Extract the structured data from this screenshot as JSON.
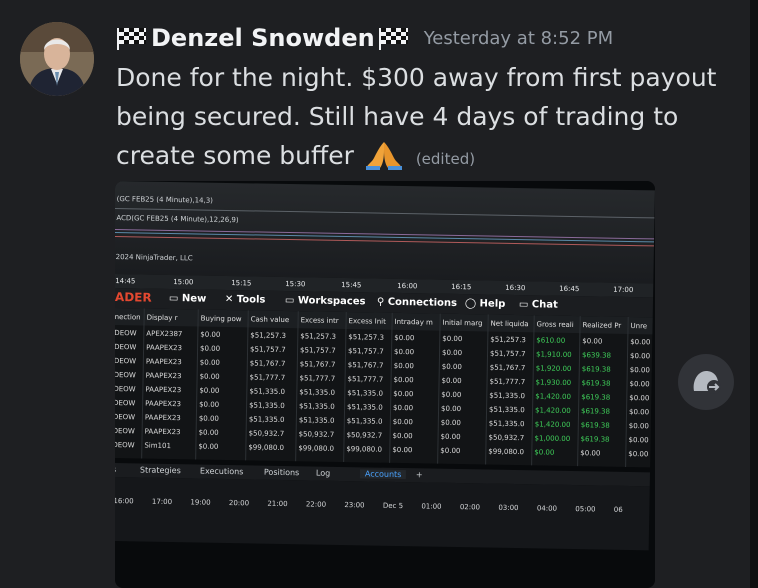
{
  "message": {
    "username": "Denzel Snowden",
    "timestamp": "Yesterday at 8:52 PM",
    "text": "Done for the night. $300 away from first payout being secured. Still have 4 days of trading to create some buffer",
    "edited": "(edited)",
    "flag_icon": "checkered-flag-icon",
    "emoji_icon": "folded-hands-icon"
  },
  "screenshot": {
    "indicators": [
      "(GC FEB25 (4 Minute),14,3)",
      "ACD(GC FEB25 (4 Minute),12,26,9)"
    ],
    "copyright": "2024 NinjaTrader, LLC",
    "top_times": [
      "14:45",
      "15:00",
      "15:15",
      "15:30",
      "15:45",
      "16:00",
      "16:15",
      "16:30",
      "16:45",
      "17:00"
    ],
    "brand": "ADER",
    "menu": [
      "New",
      "Tools",
      "Workspaces",
      "Connections",
      "Help",
      "Chat"
    ],
    "columns": [
      "nection",
      "Display r",
      "Buying pow",
      "Cash value",
      "Excess intr",
      "Excess Init",
      "Intraday m",
      "Initial marg",
      "Net liquida",
      "Gross reali",
      "Realized Pr",
      "Unre"
    ],
    "rows": [
      [
        "DEOW",
        "APEX2387",
        "$0.00",
        "$51,257.3",
        "$51,257.3",
        "$51,257.3",
        "$0.00",
        "$0.00",
        "$51,257.3",
        "$610.00",
        "$0.00",
        "$0.00"
      ],
      [
        "DEOW",
        "PAAPEX23",
        "$0.00",
        "$51,757.7",
        "$51,757.7",
        "$51,757.7",
        "$0.00",
        "$0.00",
        "$51,757.7",
        "$1,910.00",
        "$639.38",
        "$0.00"
      ],
      [
        "DEOW",
        "PAAPEX23",
        "$0.00",
        "$51,767.7",
        "$51,767.7",
        "$51,767.7",
        "$0.00",
        "$0.00",
        "$51,767.7",
        "$1,920.00",
        "$619.38",
        "$0.00"
      ],
      [
        "DEOW",
        "PAAPEX23",
        "$0.00",
        "$51,777.7",
        "$51,777.7",
        "$51,777.7",
        "$0.00",
        "$0.00",
        "$51,777.7",
        "$1,930.00",
        "$619.38",
        "$0.00"
      ],
      [
        "DEOW",
        "PAAPEX23",
        "$0.00",
        "$51,335.0",
        "$51,335.0",
        "$51,335.0",
        "$0.00",
        "$0.00",
        "$51,335.0",
        "$1,420.00",
        "$619.38",
        "$0.00"
      ],
      [
        "DEOW",
        "PAAPEX23",
        "$0.00",
        "$51,335.0",
        "$51,335.0",
        "$51,335.0",
        "$0.00",
        "$0.00",
        "$51,335.0",
        "$1,420.00",
        "$619.38",
        "$0.00"
      ],
      [
        "DEOW",
        "PAAPEX23",
        "$0.00",
        "$51,335.0",
        "$51,335.0",
        "$51,335.0",
        "$0.00",
        "$0.00",
        "$51,335.0",
        "$1,420.00",
        "$619.38",
        "$0.00"
      ],
      [
        "DEOW",
        "PAAPEX23",
        "$0.00",
        "$50,932.7",
        "$50,932.7",
        "$50,932.7",
        "$0.00",
        "$0.00",
        "$50,932.7",
        "$1,000.00",
        "$619.38",
        "$0.00"
      ],
      [
        "DEOW",
        "Sim101",
        "$0.00",
        "$99,080.0",
        "$99,080.0",
        "$99,080.0",
        "$0.00",
        "$0.00",
        "$99,080.0",
        "$0.00",
        "$0.00",
        "$0.00"
      ]
    ],
    "tabs": [
      "s",
      "Strategies",
      "Executions",
      "Positions",
      "Log",
      "Accounts",
      "+"
    ],
    "bottom_times": [
      "16:00",
      "17:00",
      "19:00",
      "20:00",
      "21:00",
      "22:00",
      "23:00",
      "Dec 5",
      "01:00",
      "02:00",
      "03:00",
      "04:00",
      "05:00",
      "06"
    ]
  },
  "actions": {
    "forward_icon": "forward-message-icon"
  }
}
